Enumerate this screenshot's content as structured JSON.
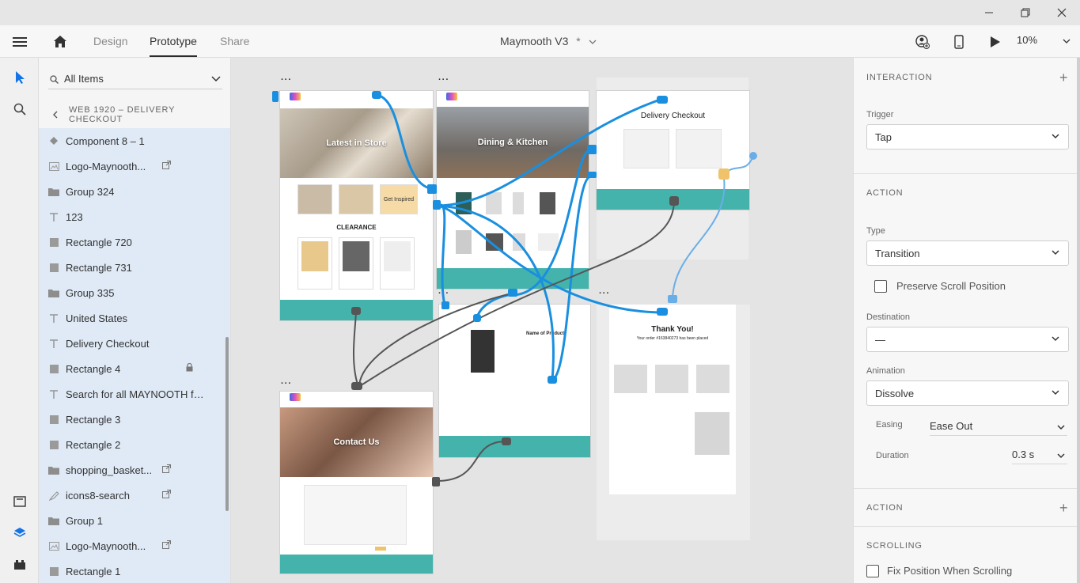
{
  "toolbar": {
    "tabs": [
      {
        "label": "Design"
      },
      {
        "label": "Prototype"
      },
      {
        "label": "Share"
      }
    ],
    "doc_title": "Maymooth V3",
    "modified_marker": "*",
    "zoom": "10%"
  },
  "layers": {
    "search_placeholder": "All Items",
    "breadcrumb": "WEB 1920 – DELIVERY CHECKOUT",
    "items": [
      {
        "label": "Component 8 – 1",
        "icon": "component-icon"
      },
      {
        "label": "Logo-Maynooth...",
        "icon": "image-icon",
        "link": true
      },
      {
        "label": "Group 324",
        "icon": "folder-icon"
      },
      {
        "label": "123",
        "icon": "text-icon"
      },
      {
        "label": "Rectangle 720",
        "icon": "rectangle-icon"
      },
      {
        "label": "Rectangle 731",
        "icon": "rectangle-icon"
      },
      {
        "label": "Group 335",
        "icon": "folder-icon"
      },
      {
        "label": "United States",
        "icon": "text-icon"
      },
      {
        "label": "Delivery Checkout",
        "icon": "text-icon"
      },
      {
        "label": "Rectangle 4",
        "icon": "rectangle-icon",
        "locked": true
      },
      {
        "label": "Search for all MAYNOOTH furnit...",
        "icon": "text-icon"
      },
      {
        "label": "Rectangle 3",
        "icon": "rectangle-icon"
      },
      {
        "label": "Rectangle 2",
        "icon": "rectangle-icon"
      },
      {
        "label": "shopping_basket...",
        "icon": "folder-icon",
        "link": true
      },
      {
        "label": "icons8-search",
        "icon": "path-icon",
        "link": true
      },
      {
        "label": "Group 1",
        "icon": "folder-icon"
      },
      {
        "label": "Logo-Maynooth...",
        "icon": "image-icon",
        "link": true
      },
      {
        "label": "Rectangle 1",
        "icon": "rectangle-icon"
      }
    ]
  },
  "canvas": {
    "artboards": {
      "home": {
        "hero": "Latest in Store",
        "promo": "Get Inspired",
        "section": "CLEARANCE"
      },
      "dining": {
        "hero": "Dining & Kitchen"
      },
      "checkout": {
        "title": "Delivery Checkout"
      },
      "product": {
        "title": "Name of Product"
      },
      "thanks": {
        "title": "Thank You!",
        "subtitle": "Your order #163840273 has been placed"
      },
      "contact": {
        "hero": "Contact Us"
      }
    }
  },
  "properties": {
    "interaction_title": "INTERACTION",
    "trigger_label": "Trigger",
    "trigger_value": "Tap",
    "action_title": "ACTION",
    "type_label": "Type",
    "type_value": "Transition",
    "preserve_scroll": "Preserve Scroll Position",
    "destination_label": "Destination",
    "destination_value": "—",
    "animation_label": "Animation",
    "animation_value": "Dissolve",
    "easing_label": "Easing",
    "easing_value": "Ease Out",
    "duration_label": "Duration",
    "duration_value": "0.3 s",
    "action2_title": "ACTION",
    "scrolling_title": "SCROLLING",
    "fix_position": "Fix Position When Scrolling"
  },
  "colors": {
    "wire_blue": "#1a8fe0",
    "wire_gray": "#555555",
    "teal": "#43b3ac",
    "accent_blue": "#1473e6"
  }
}
